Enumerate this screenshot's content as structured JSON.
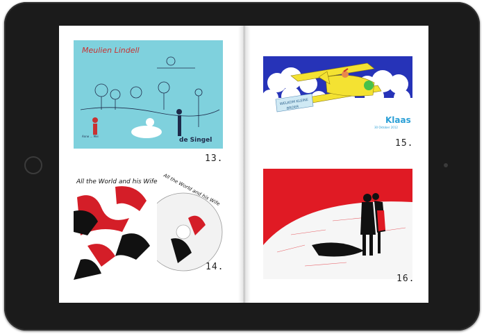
{
  "pages": [
    {
      "number": "13.",
      "artwork": {
        "poster_title": "Meulien Lindell",
        "venue_logo": "de Singel",
        "caption": "Anne ... Mei",
        "colors": {
          "background": "#7fd1dd",
          "ink": "#1e2a4a",
          "accent": "#c83232"
        }
      }
    },
    {
      "number": "14.",
      "artwork": {
        "sleeve_title": "All the World and his Wife",
        "disc_title": "All the World and his Wife",
        "colors": {
          "background": "#ffffff",
          "ink": "#111111",
          "accent": "#d41e28"
        }
      }
    },
    {
      "number": "15.",
      "artwork": {
        "banner_line1": "WELKOM KLEINE",
        "banner_line2": "BROER",
        "name": "Klaas",
        "date": "30 Oktober 2012",
        "colors": {
          "background": "#2633b8",
          "plane": "#f4e232",
          "cloud": "#ffffff",
          "name": "#2a9fd6"
        }
      }
    },
    {
      "number": "16.",
      "artwork": {
        "colors": {
          "background": "#e01a24",
          "ink": "#111111",
          "highlight": "#f6f6f6"
        }
      }
    }
  ],
  "device": {
    "frame_color": "#1b1b1b",
    "icons": [
      "home-button-icon",
      "camera-icon"
    ]
  }
}
